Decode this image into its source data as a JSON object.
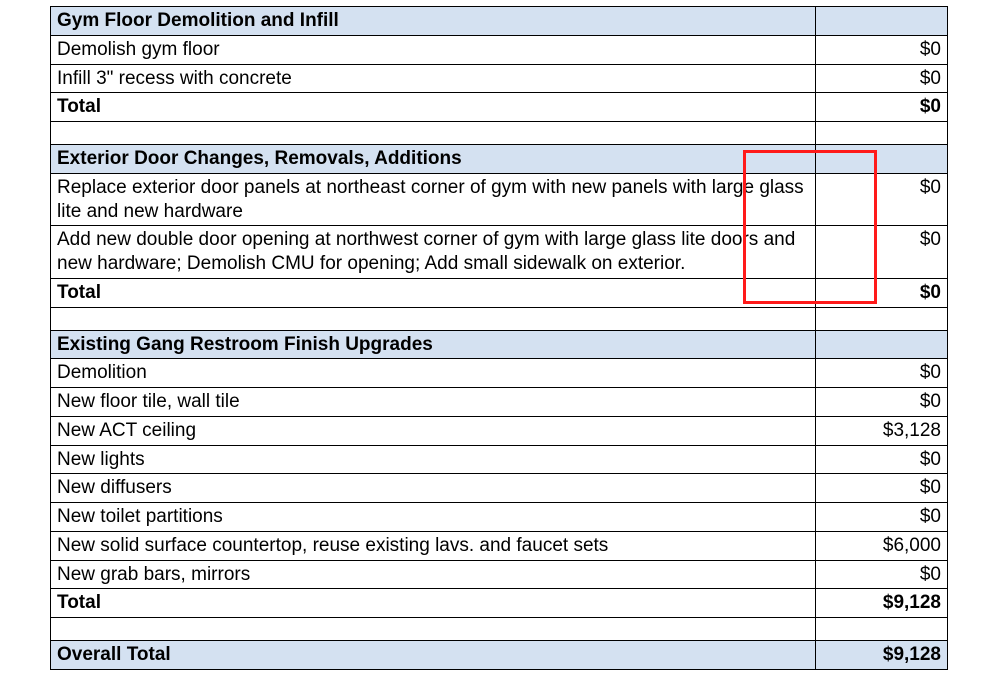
{
  "sections": [
    {
      "title": "Gym Floor Demolition and Infill",
      "items": [
        {
          "desc": "Demolish gym floor",
          "amt": "$0"
        },
        {
          "desc": "Infill 3\" recess with concrete",
          "amt": "$0"
        }
      ],
      "total_label": "Total",
      "total_amt": "$0"
    },
    {
      "title": "Exterior Door Changes, Removals, Additions",
      "items": [
        {
          "desc": "Replace exterior door panels at northeast corner of gym with new panels with large glass lite and new hardware",
          "amt": "$0"
        },
        {
          "desc": "Add new double door opening at northwest corner of gym with large glass lite doors and new hardware; Demolish CMU for opening; Add small sidewalk on exterior.",
          "amt": "$0"
        }
      ],
      "total_label": "Total",
      "total_amt": "$0"
    },
    {
      "title": "Existing Gang Restroom Finish Upgrades",
      "items": [
        {
          "desc": "Demolition",
          "amt": "$0"
        },
        {
          "desc": "New floor tile, wall tile",
          "amt": "$0"
        },
        {
          "desc": "New ACT ceiling",
          "amt": "$3,128"
        },
        {
          "desc": "New lights",
          "amt": "$0"
        },
        {
          "desc": "New diffusers",
          "amt": "$0"
        },
        {
          "desc": "New toilet partitions",
          "amt": "$0"
        },
        {
          "desc": "New solid surface countertop, reuse existing lavs. and faucet sets",
          "amt": "$6,000"
        },
        {
          "desc": "New grab bars, mirrors",
          "amt": "$0"
        }
      ],
      "total_label": "Total",
      "total_amt": "$9,128"
    }
  ],
  "overall_label": "Overall Total",
  "overall_amt": "$9,128"
}
